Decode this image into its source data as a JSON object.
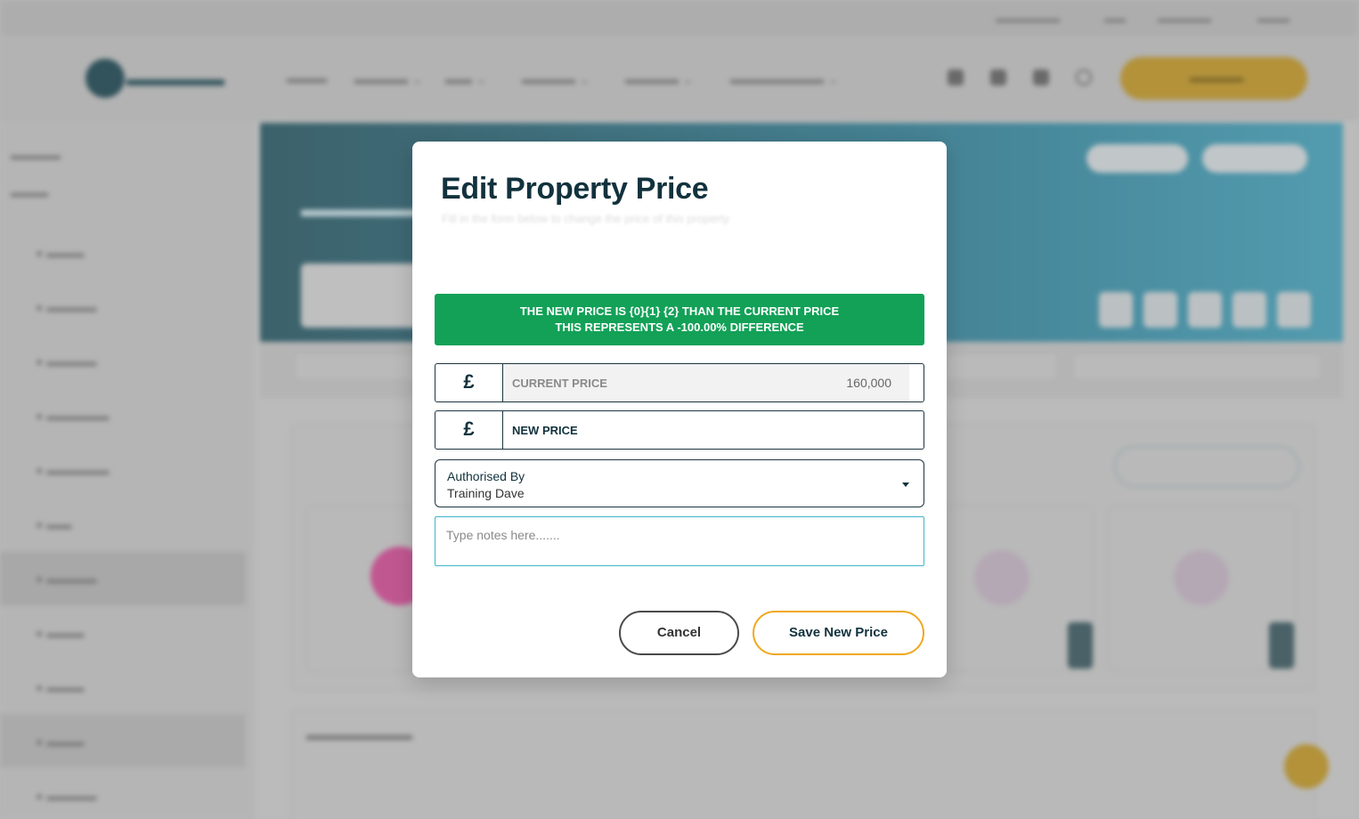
{
  "modal": {
    "title": "Edit Property Price",
    "subtitle": "Fill in the form below to change the price of this property",
    "banner": {
      "line1": "THE NEW PRICE IS {0}{1} {2} THAN THE CURRENT PRICE",
      "line2": "THIS REPRESENTS A -100.00% DIFFERENCE"
    },
    "current_price": {
      "currency_symbol": "£",
      "label": "CURRENT PRICE",
      "value": "160,000"
    },
    "new_price": {
      "currency_symbol": "£",
      "label": "NEW PRICE",
      "value": ""
    },
    "authorised_by": {
      "label": "Authorised By",
      "selected": "Training Dave"
    },
    "notes": {
      "placeholder": "Type notes here......."
    },
    "buttons": {
      "cancel": "Cancel",
      "save": "Save New Price"
    }
  },
  "colors": {
    "banner_green": "#12a157",
    "title_navy": "#12323d",
    "save_border_amber": "#f0a81c",
    "notes_border_teal": "#3fb6c9"
  }
}
